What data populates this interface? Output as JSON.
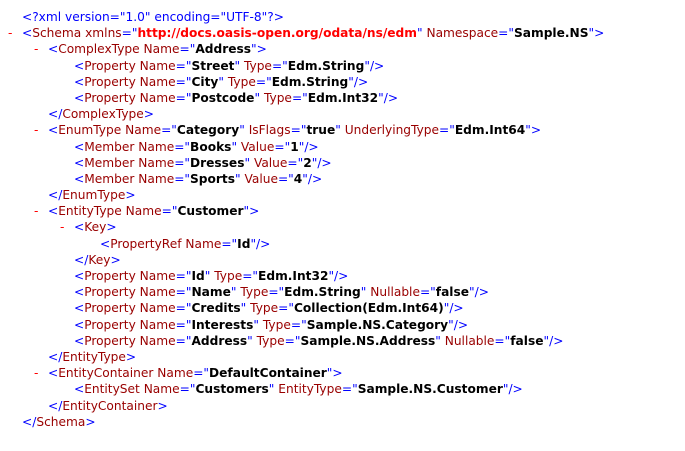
{
  "lines": [
    {
      "t": "pi",
      "depth": 0,
      "toggle": "",
      "text": "<?xml version=\"1.0\" encoding=\"UTF-8\"?>"
    },
    {
      "t": "open",
      "depth": 0,
      "toggle": "-",
      "tag": "Schema",
      "attrs": [
        {
          "n": "xmlns",
          "v": "http://docs.oasis-open.org/odata/ns/edm",
          "url": true
        },
        {
          "n": "Namespace",
          "v": "Sample.NS"
        }
      ]
    },
    {
      "t": "open",
      "depth": 1,
      "toggle": "-",
      "tag": "ComplexType",
      "attrs": [
        {
          "n": "Name",
          "v": "Address"
        }
      ]
    },
    {
      "t": "empty",
      "depth": 2,
      "toggle": "",
      "tag": "Property",
      "attrs": [
        {
          "n": "Name",
          "v": "Street"
        },
        {
          "n": "Type",
          "v": "Edm.String"
        }
      ]
    },
    {
      "t": "empty",
      "depth": 2,
      "toggle": "",
      "tag": "Property",
      "attrs": [
        {
          "n": "Name",
          "v": "City"
        },
        {
          "n": "Type",
          "v": "Edm.String"
        }
      ]
    },
    {
      "t": "empty",
      "depth": 2,
      "toggle": "",
      "tag": "Property",
      "attrs": [
        {
          "n": "Name",
          "v": "Postcode"
        },
        {
          "n": "Type",
          "v": "Edm.Int32"
        }
      ]
    },
    {
      "t": "close",
      "depth": 1,
      "toggle": "",
      "tag": "ComplexType"
    },
    {
      "t": "open",
      "depth": 1,
      "toggle": "-",
      "tag": "EnumType",
      "attrs": [
        {
          "n": "Name",
          "v": "Category"
        },
        {
          "n": "IsFlags",
          "v": "true"
        },
        {
          "n": "UnderlyingType",
          "v": "Edm.Int64"
        }
      ]
    },
    {
      "t": "empty",
      "depth": 2,
      "toggle": "",
      "tag": "Member",
      "attrs": [
        {
          "n": "Name",
          "v": "Books"
        },
        {
          "n": "Value",
          "v": "1"
        }
      ]
    },
    {
      "t": "empty",
      "depth": 2,
      "toggle": "",
      "tag": "Member",
      "attrs": [
        {
          "n": "Name",
          "v": "Dresses"
        },
        {
          "n": "Value",
          "v": "2"
        }
      ]
    },
    {
      "t": "empty",
      "depth": 2,
      "toggle": "",
      "tag": "Member",
      "attrs": [
        {
          "n": "Name",
          "v": "Sports"
        },
        {
          "n": "Value",
          "v": "4"
        }
      ]
    },
    {
      "t": "close",
      "depth": 1,
      "toggle": "",
      "tag": "EnumType"
    },
    {
      "t": "open",
      "depth": 1,
      "toggle": "-",
      "tag": "EntityType",
      "attrs": [
        {
          "n": "Name",
          "v": "Customer"
        }
      ]
    },
    {
      "t": "open",
      "depth": 2,
      "toggle": "-",
      "tag": "Key",
      "attrs": []
    },
    {
      "t": "empty",
      "depth": 3,
      "toggle": "",
      "tag": "PropertyRef",
      "attrs": [
        {
          "n": "Name",
          "v": "Id"
        }
      ]
    },
    {
      "t": "close",
      "depth": 2,
      "toggle": "",
      "tag": "Key"
    },
    {
      "t": "empty",
      "depth": 2,
      "toggle": "",
      "tag": "Property",
      "attrs": [
        {
          "n": "Name",
          "v": "Id"
        },
        {
          "n": "Type",
          "v": "Edm.Int32"
        }
      ]
    },
    {
      "t": "empty",
      "depth": 2,
      "toggle": "",
      "tag": "Property",
      "attrs": [
        {
          "n": "Name",
          "v": "Name"
        },
        {
          "n": "Type",
          "v": "Edm.String"
        },
        {
          "n": "Nullable",
          "v": "false"
        }
      ]
    },
    {
      "t": "empty",
      "depth": 2,
      "toggle": "",
      "tag": "Property",
      "attrs": [
        {
          "n": "Name",
          "v": "Credits"
        },
        {
          "n": "Type",
          "v": "Collection(Edm.Int64)"
        }
      ]
    },
    {
      "t": "empty",
      "depth": 2,
      "toggle": "",
      "tag": "Property",
      "attrs": [
        {
          "n": "Name",
          "v": "Interests"
        },
        {
          "n": "Type",
          "v": "Sample.NS.Category"
        }
      ]
    },
    {
      "t": "empty",
      "depth": 2,
      "toggle": "",
      "tag": "Property",
      "attrs": [
        {
          "n": "Name",
          "v": "Address"
        },
        {
          "n": "Type",
          "v": "Sample.NS.Address"
        },
        {
          "n": "Nullable",
          "v": "false"
        }
      ]
    },
    {
      "t": "close",
      "depth": 1,
      "toggle": "",
      "tag": "EntityType"
    },
    {
      "t": "open",
      "depth": 1,
      "toggle": "-",
      "tag": "EntityContainer",
      "attrs": [
        {
          "n": "Name",
          "v": "DefaultContainer"
        }
      ]
    },
    {
      "t": "empty",
      "depth": 2,
      "toggle": "",
      "tag": "EntitySet",
      "attrs": [
        {
          "n": "Name",
          "v": "Customers"
        },
        {
          "n": "EntityType",
          "v": "Sample.NS.Customer"
        }
      ]
    },
    {
      "t": "close",
      "depth": 1,
      "toggle": "",
      "tag": "EntityContainer"
    },
    {
      "t": "close",
      "depth": 0,
      "toggle": "",
      "tag": "Schema"
    }
  ],
  "colors": {
    "bracket": "#0000ff",
    "tag_name": "#990000",
    "attr_name": "#990000",
    "attr_value": "#000000",
    "url_value": "#ff0000",
    "toggle": "#ff0000",
    "background": "#ffffff"
  }
}
